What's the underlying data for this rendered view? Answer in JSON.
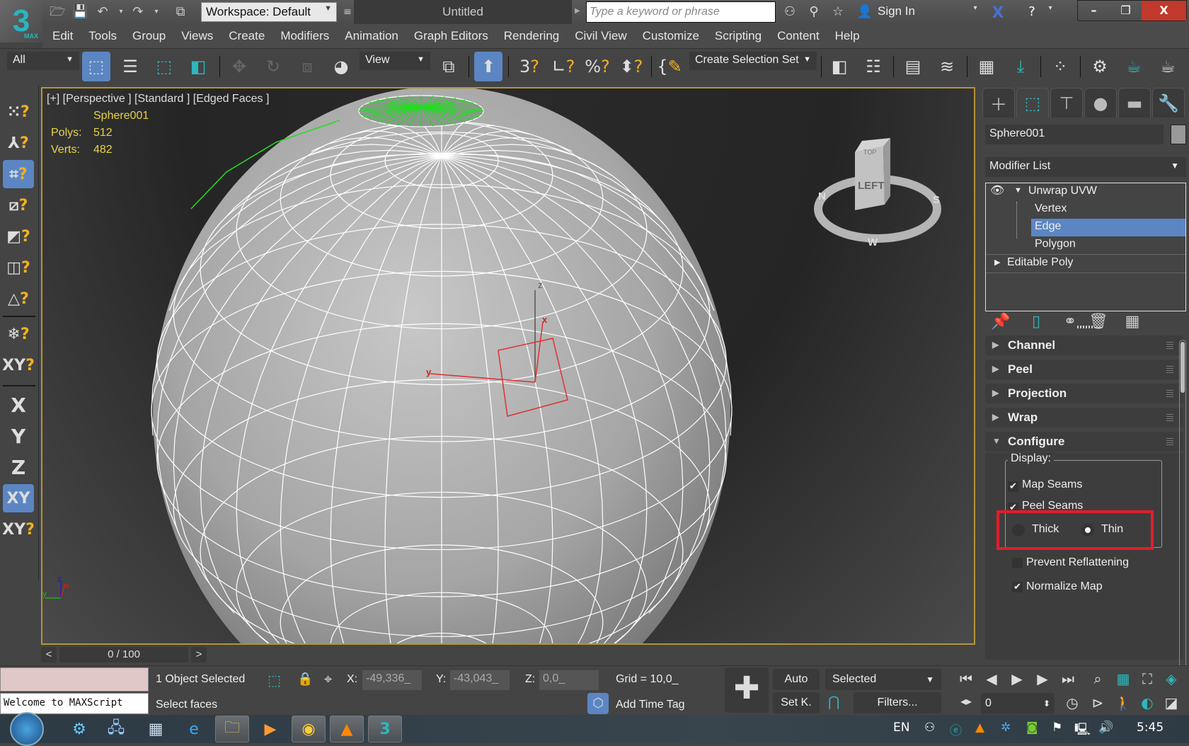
{
  "app": {
    "logo_text": "3",
    "logo_sub": "MAX",
    "title": "Untitled",
    "workspace": "Workspace: Default",
    "search_placeholder": "Type a keyword or phrase",
    "sign_in": "Sign In"
  },
  "quick_access": [
    "open-icon",
    "save-icon",
    "undo-icon",
    "redo-icon",
    "project-icon"
  ],
  "window_controls": {
    "minimize": "–",
    "restore": "❐",
    "close": "X"
  },
  "menu": [
    "Edit",
    "Tools",
    "Group",
    "Views",
    "Create",
    "Modifiers",
    "Animation",
    "Graph Editors",
    "Rendering",
    "Civil View",
    "Customize",
    "Scripting",
    "Content",
    "Help"
  ],
  "toolbar": {
    "selection_filter": "All",
    "reference_coord": "View",
    "named_selection": "Create Selection Set"
  },
  "left_strip": {
    "axis_x": "X",
    "axis_y": "Y",
    "axis_z": "Z",
    "axis_xy": "XY",
    "xy_snap": "XY"
  },
  "viewport": {
    "label": "[+] [Perspective ] [Standard ] [Edged Faces ]",
    "object_name": "Sphere001",
    "polys_label": "Polys:",
    "polys_value": "512",
    "verts_label": "Verts:",
    "verts_value": "482",
    "gizmo": {
      "x": "x",
      "y": "y",
      "z": "z"
    },
    "viewcube": {
      "face": "LEFT",
      "top": "TOP",
      "compass": [
        "N",
        "S",
        "W"
      ]
    }
  },
  "command_panel": {
    "object_name": "Sphere001",
    "modifier_list": "Modifier List",
    "stack": [
      {
        "label": "Unwrap UVW",
        "type": "modifier",
        "expanded": true
      },
      {
        "label": "Vertex",
        "type": "sub"
      },
      {
        "label": "Edge",
        "type": "sub",
        "selected": true
      },
      {
        "label": "Polygon",
        "type": "sub"
      },
      {
        "label": "Editable Poly",
        "type": "base"
      }
    ],
    "rollouts": [
      {
        "label": "Channel",
        "open": false
      },
      {
        "label": "Peel",
        "open": false
      },
      {
        "label": "Projection",
        "open": false
      },
      {
        "label": "Wrap",
        "open": false
      },
      {
        "label": "Configure",
        "open": true
      }
    ],
    "configure": {
      "display_label": "Display:",
      "map_seams": {
        "label": "Map Seams",
        "checked": true
      },
      "peel_seams": {
        "label": "Peel Seams",
        "checked": true
      },
      "thick": {
        "label": "Thick",
        "selected": false
      },
      "thin": {
        "label": "Thin",
        "selected": true
      },
      "prevent_reflattening": {
        "label": "Prevent Reflattening",
        "checked": false
      },
      "normalize_map": {
        "label": "Normalize Map",
        "checked": true
      }
    }
  },
  "timeline": {
    "prev": "<",
    "frame": "0 / 100",
    "next": ">"
  },
  "status": {
    "maxscript_welcome": "Welcome to MAXScript",
    "selection": "1 Object Selected",
    "prompt": "Select faces",
    "x_label": "X:",
    "x_value": "-49,336_",
    "y_label": "Y:",
    "y_value": "-43,043_",
    "z_label": "Z:",
    "z_value": "0,0_",
    "grid": "Grid = 10,0_",
    "add_time_tag": "Add Time Tag",
    "auto_key": "Auto",
    "set_key": "Set K.",
    "key_filter": "Selected",
    "filters": "Filters...",
    "current_frame": "0"
  },
  "taskbar": {
    "lang": "EN",
    "time": "5:45"
  },
  "colors": {
    "accent_blue": "#5b86c3",
    "viewport_border": "#b39436",
    "highlight_red": "#e21d2a",
    "snap_yellow": "#f2b021",
    "teal": "#2fb7bd",
    "stat_yellow": "#e8d344"
  }
}
